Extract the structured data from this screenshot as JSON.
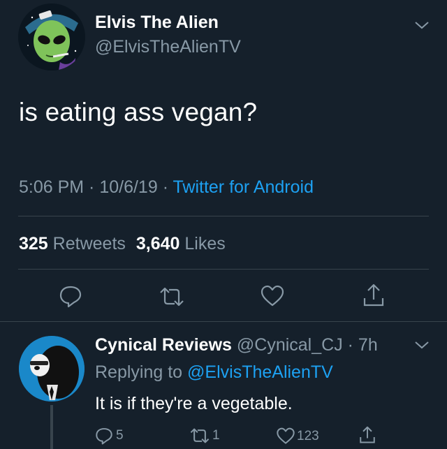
{
  "tweet": {
    "author_name": "Elvis The Alien",
    "author_handle": "@ElvisTheAlienTV",
    "text": "is eating ass vegan?",
    "time": "5:06 PM",
    "date": "10/6/19",
    "sep1": " · ",
    "sep2": " · ",
    "source": "Twitter for Android",
    "retweets_count": "325",
    "retweets_label": "Retweets",
    "likes_count": "3,640",
    "likes_label": "Likes"
  },
  "reply": {
    "author_name": "Cynical Reviews",
    "author_handle": "@Cynical_CJ",
    "time_sep": " · ",
    "time": "7h",
    "replying_prefix": "Replying to ",
    "replying_to": "@ElvisTheAlienTV",
    "text": "It is if they're a vegetable.",
    "reply_count": "5",
    "retweet_count": "1",
    "like_count": "123"
  },
  "colors": {
    "background": "#15202b",
    "muted": "#8899a6",
    "accent": "#1da1f2",
    "divider": "#38444d"
  },
  "icons": [
    "chevron-down-icon",
    "reply-icon",
    "retweet-icon",
    "like-icon",
    "share-icon"
  ]
}
